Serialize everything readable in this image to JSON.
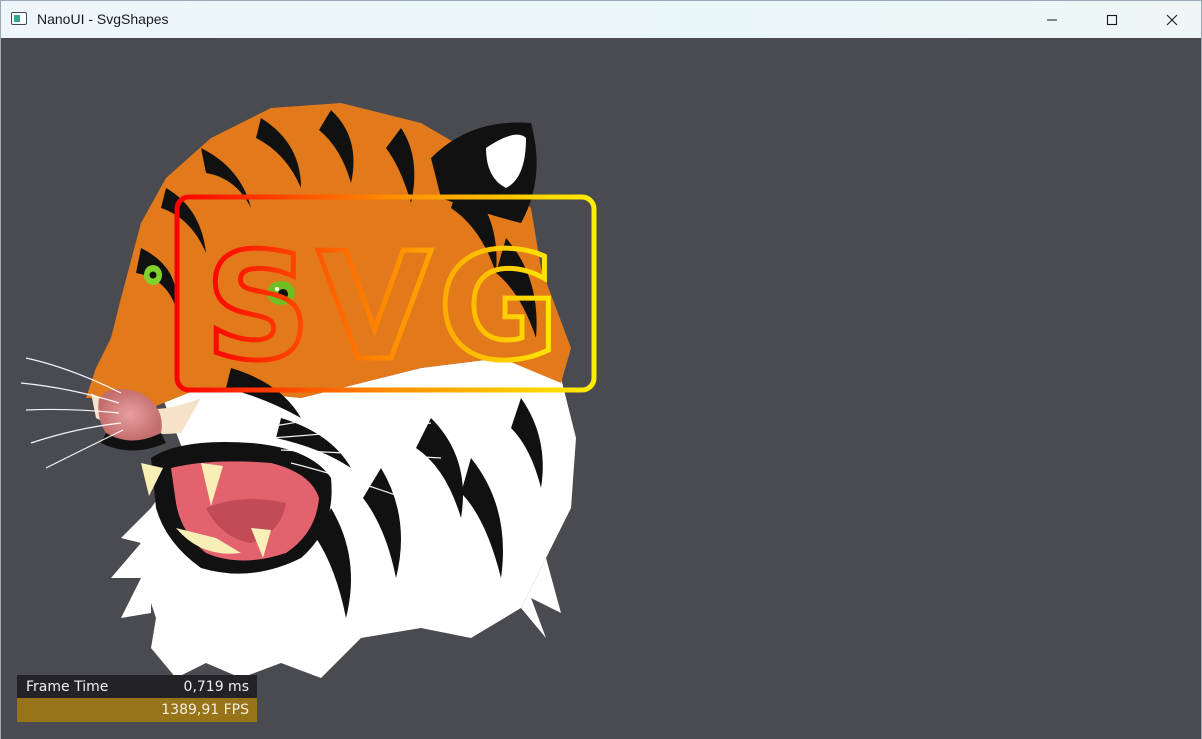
{
  "window": {
    "title": "NanoUI - SvgShapes",
    "app_icon": "window-app-icon",
    "controls": [
      "minimize-icon",
      "maximize-icon",
      "close-icon"
    ]
  },
  "canvas": {
    "background": "#4a4a51",
    "svg_text": "SVG",
    "gradient_colors": [
      "#ff0000",
      "#ff8800",
      "#ffff00"
    ]
  },
  "perf": {
    "frame_time_label": "Frame Time",
    "frame_time_value": "0,719 ms",
    "fps_value": "1389,91 FPS"
  }
}
